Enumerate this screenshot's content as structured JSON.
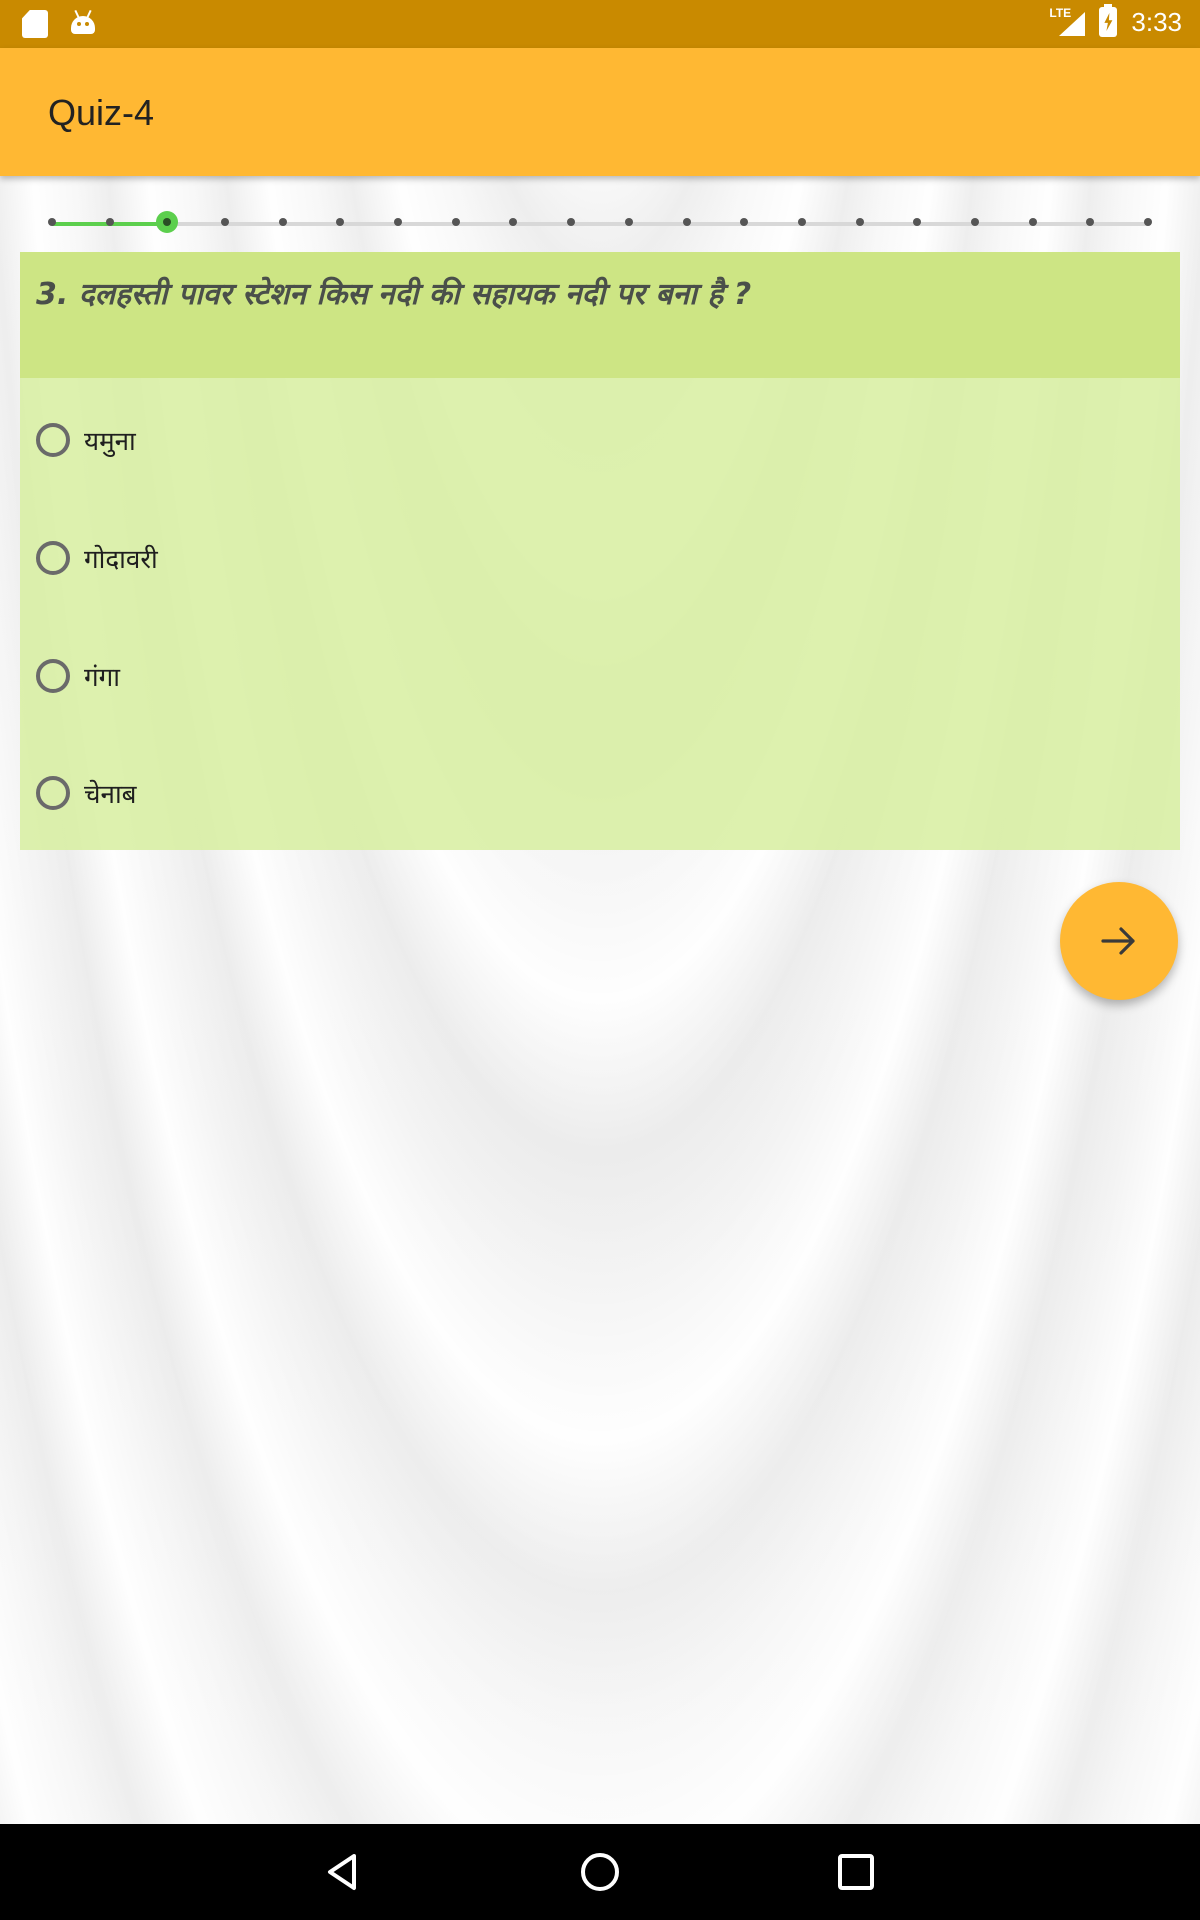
{
  "status_bar": {
    "time": "3:33",
    "network": "LTE",
    "icons": [
      "sd-card-icon",
      "android-icon",
      "signal-icon",
      "battery-charging-icon"
    ]
  },
  "app_bar": {
    "title": "Quiz-4"
  },
  "progress": {
    "total_questions": 20,
    "current_question": 3
  },
  "question": {
    "text": "3. दलहस्ती पावर स्टेशन किस नदी की सहायक नदी पर बना है ?",
    "options": [
      "यमुना",
      "गोदावरी",
      "गंगा",
      "चेनाब"
    ]
  },
  "fab": {
    "icon": "arrow-right-icon"
  },
  "nav_bar": {
    "icons": [
      "back-icon",
      "home-icon",
      "recents-icon"
    ]
  },
  "colors": {
    "status_bar": "#c98a00",
    "app_bar": "#ffb833",
    "progress_accent": "#5ccf4d",
    "question_header": "#cde584",
    "options_bg": "#d7eea0"
  }
}
